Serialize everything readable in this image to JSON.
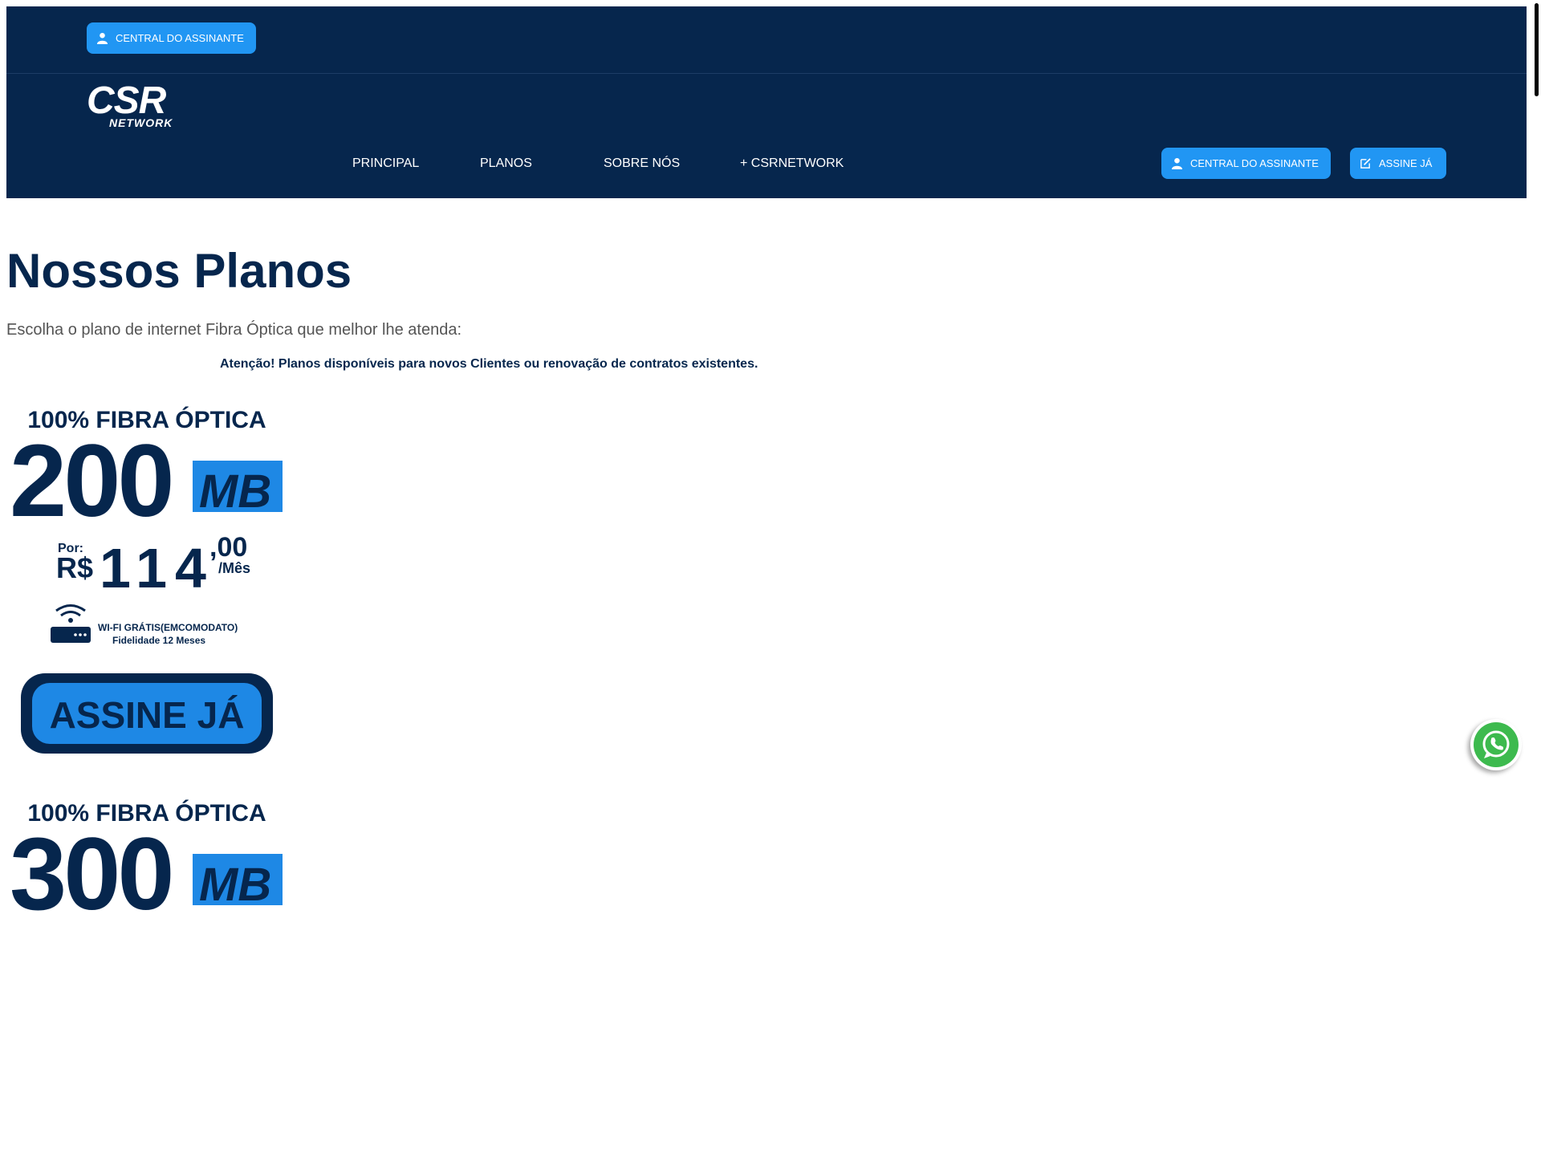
{
  "header": {
    "top_button": {
      "label": "CENTRAL DO ASSINANTE",
      "icon": "user-icon"
    },
    "logo": {
      "main": "CSR",
      "sub": "NETWORK"
    },
    "nav": [
      {
        "label": "PRINCIPAL"
      },
      {
        "label": "PLANOS"
      },
      {
        "label": "SOBRE NÓS"
      },
      {
        "label": "+ CSRNETWORK"
      }
    ],
    "cta_central": {
      "label": "CENTRAL DO ASSINANTE",
      "icon": "user-icon"
    },
    "cta_assine": {
      "label": "ASSINE JÁ",
      "icon": "edit-icon"
    }
  },
  "main": {
    "title": "Nossos Planos",
    "subtitle": "Escolha o plano de internet Fibra Óptica que melhor lhe atenda:",
    "notice": "Atenção! Planos disponíveis para novos Clientes ou renovação de contratos existentes."
  },
  "plans": [
    {
      "heading": "100% FIBRA ÓPTICA",
      "speed": "200",
      "unit": "MB",
      "price_prefix": "Por:",
      "currency": "R$",
      "price_int": "114",
      "price_dec": ",00",
      "period": "/Mês",
      "wifi": "WI-FI GRÁTIS(EMCOMODATO)",
      "fidelity": "Fidelidade 12 Meses",
      "cta": "ASSINE JÁ"
    },
    {
      "heading": "100% FIBRA ÓPTICA",
      "speed": "300",
      "unit": "MB"
    }
  ],
  "colors": {
    "navy": "#06264d",
    "accent_blue": "#2196f3",
    "whatsapp_green": "#3dba4e"
  },
  "whatsapp": {
    "icon": "whatsapp-icon"
  }
}
